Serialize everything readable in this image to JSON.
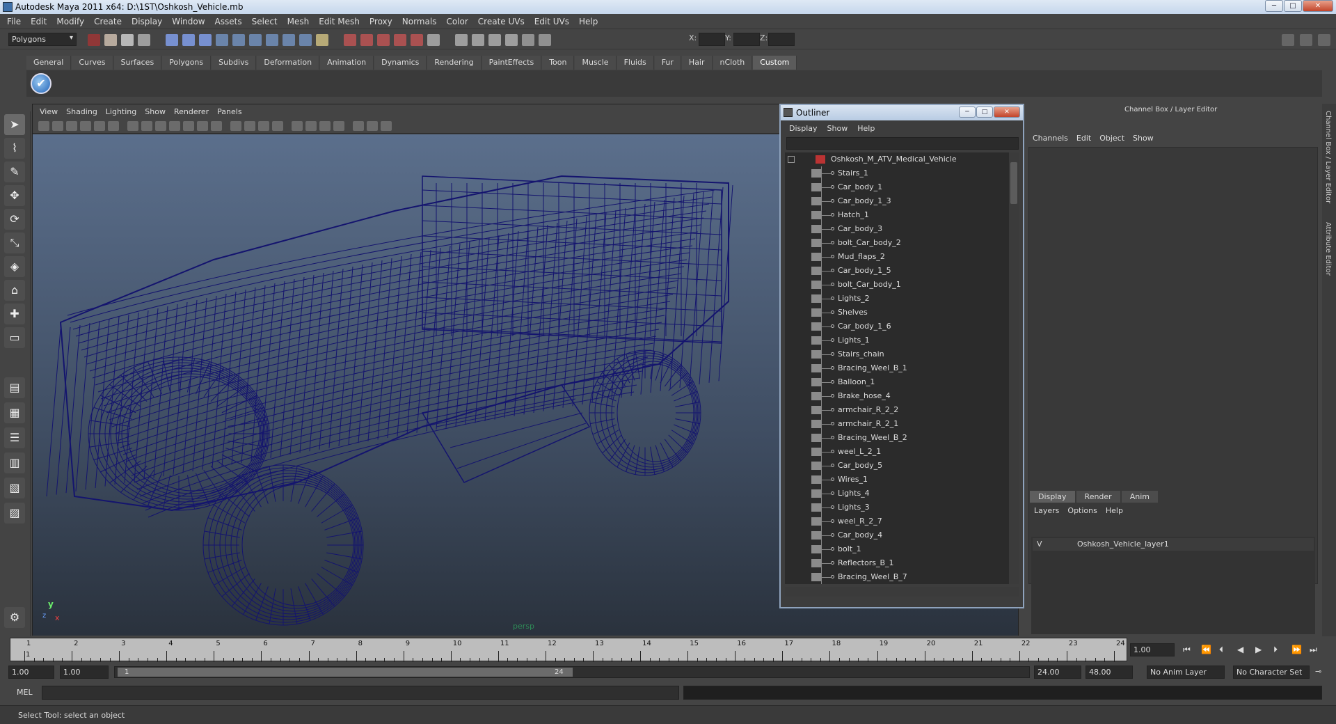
{
  "window": {
    "title": "Autodesk Maya 2011 x64: D:\\1ST\\Oshkosh_Vehicle.mb",
    "min": "─",
    "max": "□",
    "close": "✕"
  },
  "menubar": [
    "File",
    "Edit",
    "Modify",
    "Create",
    "Display",
    "Window",
    "Assets",
    "Select",
    "Mesh",
    "Edit Mesh",
    "Proxy",
    "Normals",
    "Color",
    "Create UVs",
    "Edit UVs",
    "Help"
  ],
  "status_line": {
    "mode": "Polygons",
    "x_label": "X:",
    "y_label": "Y:",
    "z_label": "Z:"
  },
  "shelf_tabs": [
    "General",
    "Curves",
    "Surfaces",
    "Polygons",
    "Subdivs",
    "Deformation",
    "Animation",
    "Dynamics",
    "Rendering",
    "PaintEffects",
    "Toon",
    "Muscle",
    "Fluids",
    "Fur",
    "Hair",
    "nCloth",
    "Custom"
  ],
  "shelf_active": "Custom",
  "viewport": {
    "menu": [
      "View",
      "Shading",
      "Lighting",
      "Show",
      "Renderer",
      "Panels"
    ],
    "camera": "persp",
    "axis_y": "y",
    "axis_x": "x",
    "axis_z": "z",
    "wire_color": "#14146e"
  },
  "outliner": {
    "title": "Outliner",
    "menu": [
      "Display",
      "Show",
      "Help"
    ],
    "root": "Oshkosh_M_ATV_Medical_Vehicle",
    "items": [
      "Stairs_1",
      "Car_body_1",
      "Car_body_1_3",
      "Hatch_1",
      "Car_body_3",
      "bolt_Car_body_2",
      "Mud_flaps_2",
      "Car_body_1_5",
      "bolt_Car_body_1",
      "Lights_2",
      "Shelves",
      "Car_body_1_6",
      "Lights_1",
      "Stairs_chain",
      "Bracing_Weel_B_1",
      "Balloon_1",
      "Brake_hose_4",
      "armchair_R_2_2",
      "armchair_R_2_1",
      "Bracing_Weel_B_2",
      "weel_L_2_1",
      "Car_body_5",
      "Wires_1",
      "Lights_4",
      "Lights_3",
      "weel_R_2_7",
      "Car_body_4",
      "bolt_1",
      "Reflectors_B_1",
      "Bracing_Weel_B_7"
    ]
  },
  "channel_box": {
    "title": "Channel Box / Layer Editor",
    "menu": [
      "Channels",
      "Edit",
      "Object",
      "Show"
    ],
    "layer_tabs": [
      "Display",
      "Render",
      "Anim"
    ],
    "layer_menu": [
      "Layers",
      "Options",
      "Help"
    ],
    "layer_visible": "V",
    "layer_name": "Oshkosh_Vehicle_layer1",
    "side_tab_1": "Channel Box / Layer Editor",
    "side_tab_2": "Attribute Editor"
  },
  "time_slider": {
    "ticks": [
      "1",
      "2",
      "3",
      "4",
      "5",
      "6",
      "7",
      "8",
      "9",
      "10",
      "11",
      "12",
      "13",
      "14",
      "15",
      "16",
      "17",
      "18",
      "19",
      "20",
      "21",
      "22",
      "23",
      "24"
    ],
    "current_marker": "1",
    "current_frame": "1.00"
  },
  "range_slider": {
    "start": "1.00",
    "playback_start": "1.00",
    "bar_start": "1",
    "bar_end": "24",
    "playback_end": "24.00",
    "end": "48.00",
    "anim_layer": "No Anim Layer",
    "char_set": "No Character Set"
  },
  "command_line": {
    "label": "MEL"
  },
  "help_line": {
    "text": "Select Tool: select an object"
  }
}
